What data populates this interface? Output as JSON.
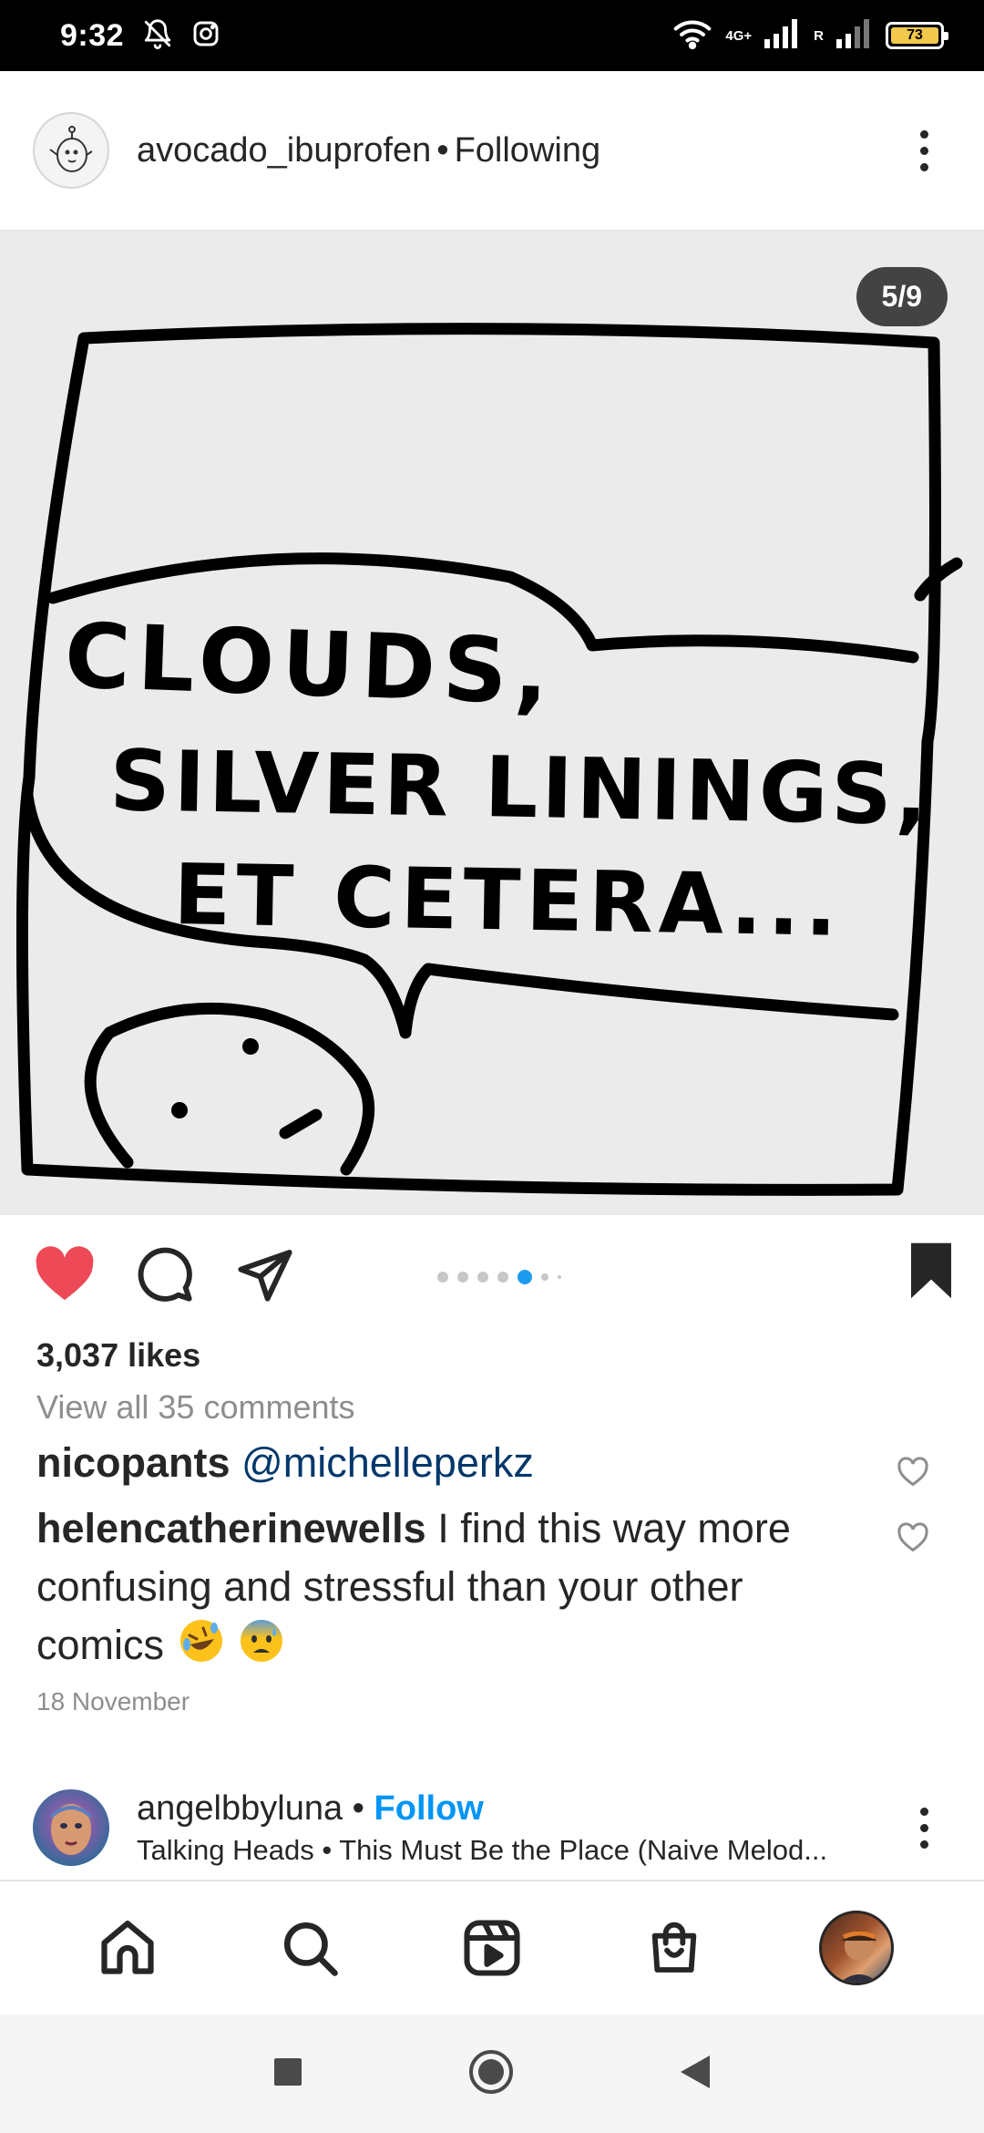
{
  "status_bar": {
    "time": "9:32",
    "network_label": "4G+",
    "roaming_label": "R",
    "battery": "73"
  },
  "post": {
    "username": "avocado_ibuprofen",
    "separator": "•",
    "following": "Following",
    "page_counter": "5/9",
    "comic_text": [
      "CLOUDS,",
      "SILVER LININGS,",
      "ET CETERA..."
    ],
    "carousel": {
      "total": 9,
      "current": 5
    },
    "likes": "3,037 likes",
    "view_comments": "View all 35 comments",
    "comments": [
      {
        "user": "nicopants",
        "text": "@michelleperkz"
      },
      {
        "user": "helencatherinewells",
        "text": "I find this way more confusing and stressful than your other comics"
      }
    ],
    "date": "18 November"
  },
  "next_post": {
    "username": "angelbbyluna",
    "separator": "•",
    "follow": "Follow",
    "audio": "Talking Heads • This Must Be the Place (Naive Melod..."
  },
  "colors": {
    "like_red": "#ed4956",
    "follow_blue": "#0095f6",
    "mention_blue": "#00376b",
    "dot_active": "#1d9bf0"
  },
  "icons": {
    "status": [
      "do-not-disturb-icon",
      "instagram-icon",
      "wifi-icon",
      "signal-icon",
      "battery-icon"
    ],
    "actions": [
      "heart-filled-icon",
      "comment-icon",
      "share-icon",
      "bookmark-filled-icon"
    ],
    "nav": [
      "home-icon",
      "search-icon",
      "reels-icon",
      "shop-icon",
      "profile-avatar"
    ],
    "system": [
      "recents-icon",
      "home-circle-icon",
      "back-icon"
    ]
  }
}
